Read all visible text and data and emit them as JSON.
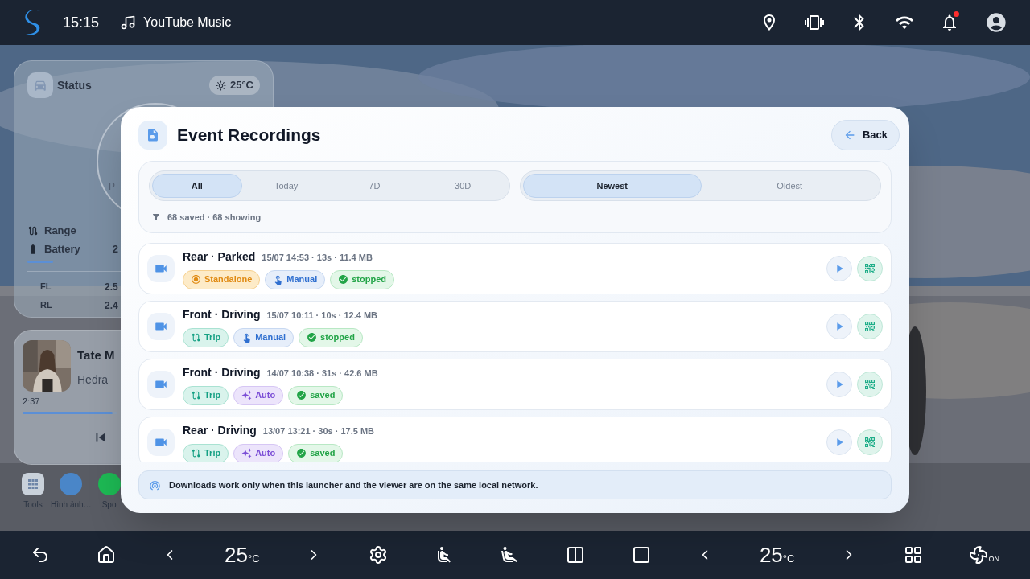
{
  "status_bar": {
    "time": "15:15",
    "now_playing": "YouTube Music",
    "has_notification": true
  },
  "home": {
    "status_card": {
      "title": "Status",
      "temperature": "25°C",
      "gear": "P",
      "stats": [
        {
          "kind": "range",
          "label": "Range"
        },
        {
          "kind": "battery",
          "label": "Battery",
          "value": "2"
        }
      ],
      "tires": [
        {
          "label": "FL",
          "value": "2.5"
        },
        {
          "label": "RL",
          "value": "2.4"
        }
      ]
    },
    "music_card": {
      "title": "Tate M",
      "artist": "Hedra",
      "elapsed": "2:37",
      "level": 0.95
    },
    "dock": [
      {
        "kind": "tools",
        "label": "Tools"
      },
      {
        "kind": "photos",
        "label": "Hình ảnh…"
      },
      {
        "kind": "music",
        "label": "Spo"
      }
    ]
  },
  "dialog": {
    "title": "Event Recordings",
    "back": "Back",
    "range_tabs": [
      {
        "label": "All",
        "selected": true
      },
      {
        "label": "Today",
        "selected": false
      },
      {
        "label": "7D",
        "selected": false
      },
      {
        "label": "30D",
        "selected": false
      }
    ],
    "sort_tabs": [
      {
        "label": "Newest",
        "selected": true
      },
      {
        "label": "Oldest",
        "selected": false
      }
    ],
    "summary": "68 saved · 68 showing",
    "recordings": [
      {
        "title": "Rear · Parked",
        "meta": "15/07 14:53 · 13s · 11.4 MB",
        "tags": [
          {
            "kind": "standalone",
            "label": "Standalone"
          },
          {
            "kind": "manual",
            "label": "Manual"
          },
          {
            "kind": "status",
            "label": "stopped"
          }
        ]
      },
      {
        "title": "Front · Driving",
        "meta": "15/07 10:11 · 10s · 12.4 MB",
        "tags": [
          {
            "kind": "trip",
            "label": "Trip"
          },
          {
            "kind": "manual",
            "label": "Manual"
          },
          {
            "kind": "status",
            "label": "stopped"
          }
        ]
      },
      {
        "title": "Front · Driving",
        "meta": "14/07 10:38 · 31s · 42.6 MB",
        "tags": [
          {
            "kind": "trip",
            "label": "Trip"
          },
          {
            "kind": "auto",
            "label": "Auto"
          },
          {
            "kind": "status",
            "label": "saved"
          }
        ]
      },
      {
        "title": "Rear · Driving",
        "meta": "13/07 13:21 · 30s · 17.5 MB",
        "tags": [
          {
            "kind": "trip",
            "label": "Trip"
          },
          {
            "kind": "auto",
            "label": "Auto"
          },
          {
            "kind": "status",
            "label": "saved"
          }
        ]
      }
    ],
    "note": "Downloads work only when this launcher and the viewer are on the same local network."
  },
  "nav_bar": {
    "left_temp": {
      "value": "25",
      "unit": "°C"
    },
    "right_temp": {
      "value": "25",
      "unit": "°C"
    },
    "fan": "ON"
  }
}
